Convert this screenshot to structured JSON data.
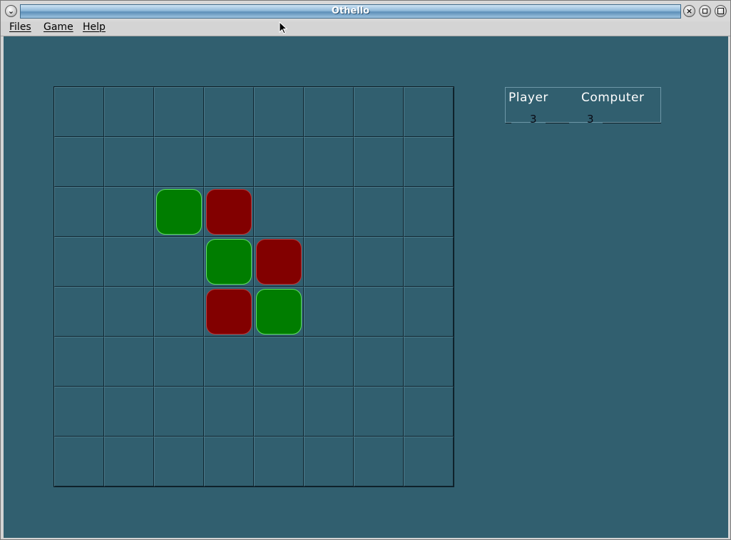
{
  "window": {
    "title": "Othello"
  },
  "menu": {
    "items": [
      "Files",
      "Game",
      "Help"
    ]
  },
  "board": {
    "size": 8,
    "cells": [
      [
        "",
        "",
        "",
        "",
        "",
        "",
        "",
        ""
      ],
      [
        "",
        "",
        "",
        "",
        "",
        "",
        "",
        ""
      ],
      [
        "",
        "",
        "green",
        "red",
        "",
        "",
        "",
        ""
      ],
      [
        "",
        "",
        "",
        "green",
        "red",
        "",
        "",
        ""
      ],
      [
        "",
        "",
        "",
        "red",
        "green",
        "",
        "",
        ""
      ],
      [
        "",
        "",
        "",
        "",
        "",
        "",
        "",
        ""
      ],
      [
        "",
        "",
        "",
        "",
        "",
        "",
        "",
        ""
      ],
      [
        "",
        "",
        "",
        "",
        "",
        "",
        "",
        ""
      ]
    ]
  },
  "score": {
    "player_label": "Player",
    "computer_label": "Computer",
    "player_value": "3",
    "computer_value": "3"
  },
  "colors": {
    "board_background": "#315f6f",
    "green_piece": "#007d00",
    "red_piece": "#820000"
  }
}
